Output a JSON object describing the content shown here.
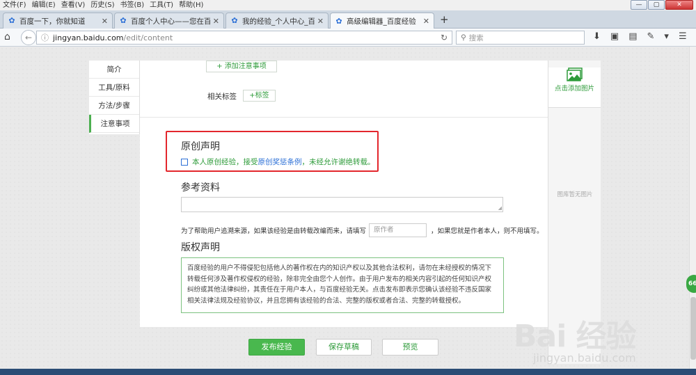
{
  "menu": [
    "文件(F)",
    "编辑(E)",
    "查看(V)",
    "历史(S)",
    "书签(B)",
    "工具(T)",
    "帮助(H)"
  ],
  "window_controls": [
    "—",
    "▢",
    "✕"
  ],
  "tabs": [
    {
      "label": "百度一下，你就知道",
      "active": false
    },
    {
      "label": "百度个人中心——您在百...",
      "active": false
    },
    {
      "label": "我的经验_个人中心_百度经...",
      "active": false
    },
    {
      "label": "高级编辑器_百度经验",
      "active": true
    }
  ],
  "newtab_label": "+",
  "nav": {
    "url_host": "jingyan.baidu.com",
    "url_path": "/edit/content",
    "search_placeholder": "搜索"
  },
  "leftnav": [
    "简介",
    "工具/原料",
    "方法/步骤",
    "注意事项"
  ],
  "editor": {
    "add_note_label": "+ 添加注意事项",
    "related_tags_label": "相关标签",
    "add_tag_label": "+标签",
    "original_title": "原创声明",
    "original_text_1": "本人原创经验，接受",
    "original_link": "原创奖惩条例",
    "original_text_2": "，未经允许谢绝转载。",
    "reference_title": "参考资料",
    "reference_note_1": "为了帮助用户追溯来源，如果该经验是由转载改编而来，请填写",
    "author_placeholder": "原作者",
    "reference_note_2": "，如果您就是作者本人，则不用填写。",
    "copyright_title": "版权声明",
    "copyright_text": "百度经验的用户不得侵犯包括他人的著作权在内的知识产权以及其他合法权利，请勿在未经授权的情况下转载任何涉及著作权侵权的经验，除非完全由您个人创作。由于用户发布的相关内容引起的任何知识产权纠纷或其他法律纠纷，其责任在于用户本人，与百度经验无关。点击发布即表示您确认该经验不违反国家相关法律法规及经验协议，并且您拥有该经验的合法、完整的版权或者合法、完整的转载授权。"
  },
  "rightpanel": {
    "add_picture_label": "点击添加图片",
    "no_picture_label": "图库暂无图片"
  },
  "actions": {
    "publish_label": "发布经验",
    "save_draft_label": "保存草稿",
    "preview_label": "预览"
  },
  "watermark": {
    "brand": "Bai 经验",
    "url": "jingyan.baidu.com"
  },
  "side_badge": "66",
  "colors": {
    "accent_green": "#49b84e",
    "link_blue": "#2b6fd6",
    "highlight_red": "#e3262c"
  }
}
